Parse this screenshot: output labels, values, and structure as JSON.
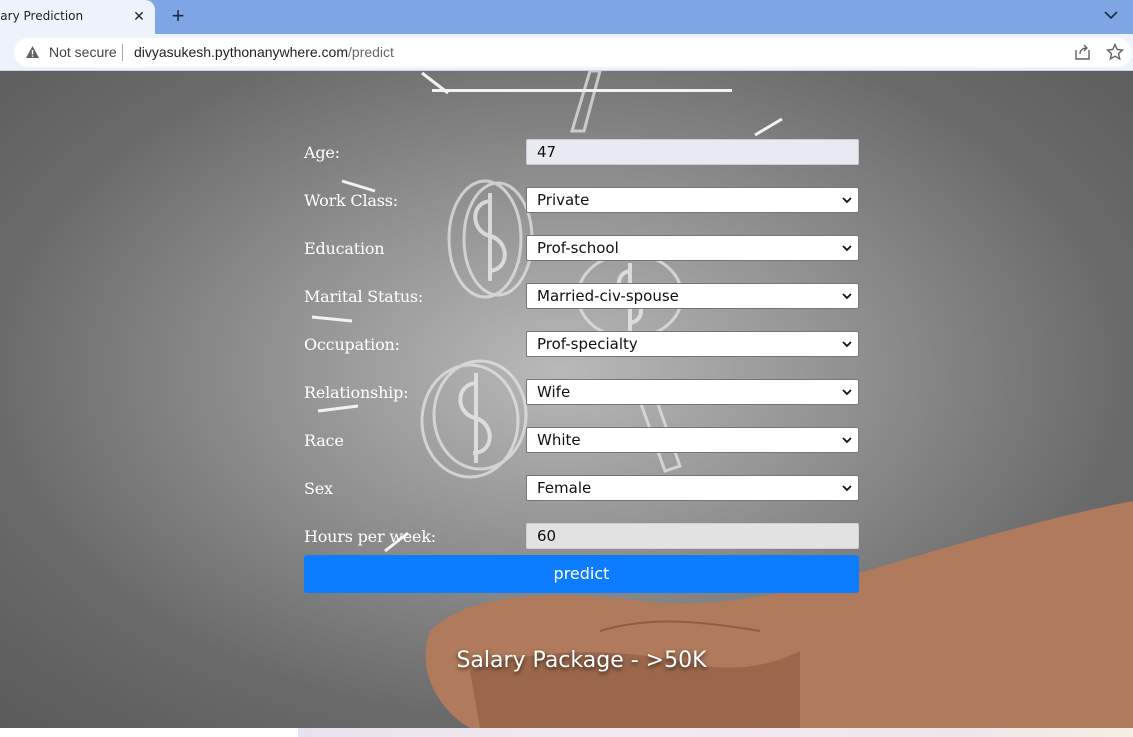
{
  "browser": {
    "tab_title": "Salary Prediction",
    "url_warning": "Not secure",
    "url_host": "divyasukesh.pythonanywhere.com",
    "url_path": "/predict"
  },
  "form": {
    "age": {
      "label": "Age:",
      "value": "47"
    },
    "work_class": {
      "label": "Work Class:",
      "value": "Private"
    },
    "education": {
      "label": "Education",
      "value": "Prof-school"
    },
    "marital_status": {
      "label": "Marital Status:",
      "value": "Married-civ-spouse"
    },
    "occupation": {
      "label": "Occupation:",
      "value": "Prof-specialty"
    },
    "relationship": {
      "label": "Relationship:",
      "value": "Wife"
    },
    "race": {
      "label": "Race",
      "value": "White"
    },
    "sex": {
      "label": "Sex",
      "value": "Female"
    },
    "hours_per_week": {
      "label": "Hours per week:",
      "value": "60"
    },
    "submit_label": "predict"
  },
  "result_text": "Salary Package - >50K"
}
